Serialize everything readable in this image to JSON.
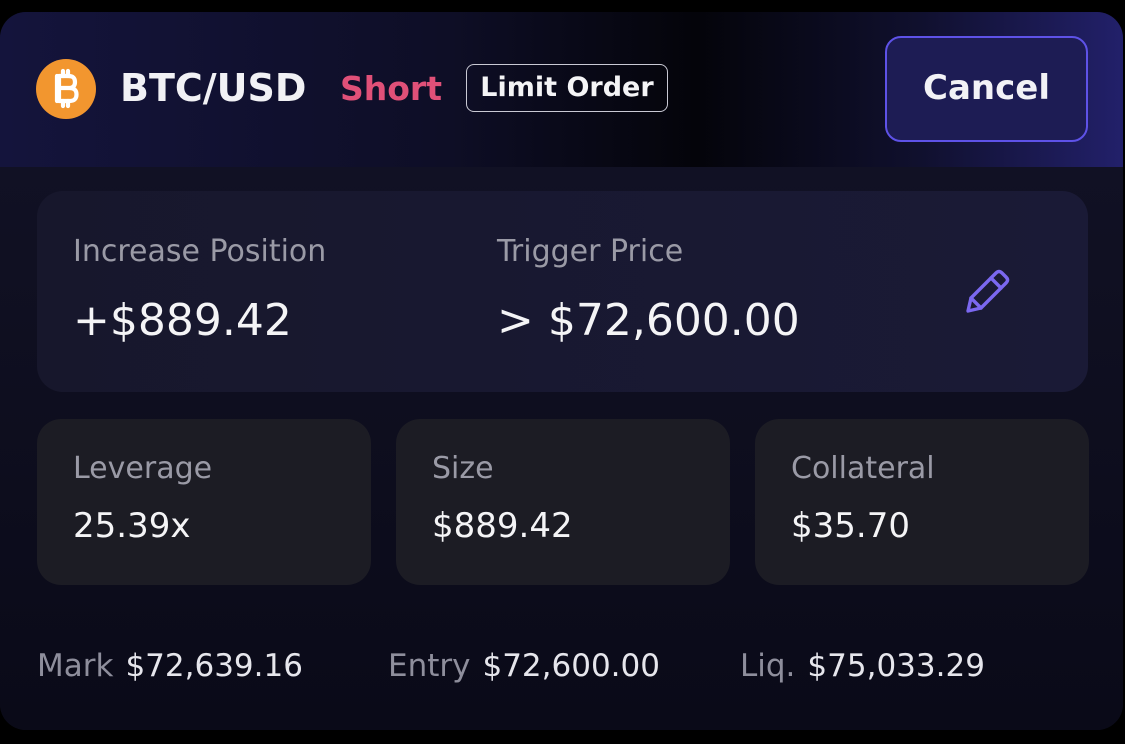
{
  "header": {
    "coin_icon": "bitcoin-icon",
    "pair": "BTC/USD",
    "side": "Short",
    "order_type": "Limit Order",
    "cancel_label": "Cancel"
  },
  "position": {
    "increase_label": "Increase Position",
    "increase_value": "+$889.42",
    "trigger_label": "Trigger Price",
    "trigger_value": "> $72,600.00",
    "edit_icon": "pencil-icon"
  },
  "stats": [
    {
      "label": "Leverage",
      "value": "25.39x"
    },
    {
      "label": "Size",
      "value": "$889.42"
    },
    {
      "label": "Collateral",
      "value": "$35.70"
    }
  ],
  "footer": {
    "mark_label": "Mark",
    "mark_value": "$72,639.16",
    "entry_label": "Entry",
    "entry_value": "$72,600.00",
    "liq_label": "Liq.",
    "liq_value": "$75,033.29"
  },
  "colors": {
    "short": "#e05078",
    "accent": "#5e52e8",
    "bitcoin": "#f2962f"
  }
}
